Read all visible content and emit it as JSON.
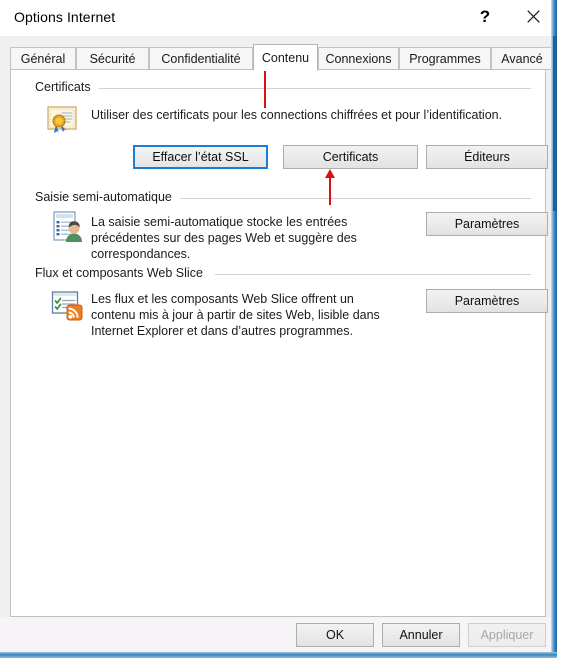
{
  "window": {
    "title": "Options Internet",
    "help_button": "?",
    "close_button": "✕",
    "help_icon": "question-mark-icon",
    "close_icon": "close-x-icon"
  },
  "tabs": [
    {
      "label": "Général",
      "active": false
    },
    {
      "label": "Sécurité",
      "active": false
    },
    {
      "label": "Confidentialité",
      "active": false
    },
    {
      "label": "Contenu",
      "active": true
    },
    {
      "label": "Connexions",
      "active": false
    },
    {
      "label": "Programmes",
      "active": false
    },
    {
      "label": "Avancé",
      "active": false
    }
  ],
  "groups": {
    "certificates": {
      "title": "Certificats",
      "icon": "certificate-seal-icon",
      "description": "Utiliser des certificats pour les connections chiffrées et pour l’identification.",
      "buttons": [
        {
          "label": "Effacer l’état SSL",
          "state": "focused"
        },
        {
          "label": "Certificats",
          "state": "normal"
        },
        {
          "label": "Éditeurs",
          "state": "normal"
        }
      ]
    },
    "autocomplete": {
      "title": "Saisie semi-automatique",
      "icon": "autocomplete-form-person-icon",
      "description": "La saisie semi-automatique stocke les entrées précédentes sur des pages Web et suggère des correspondances.",
      "settings_button": "Paramètres"
    },
    "feeds": {
      "title": "Flux et composants Web Slice",
      "icon": "rss-webslice-icon",
      "description": "Les flux et les composants Web Slice offrent un contenu mis à jour à partir de sites Web, lisible dans Internet Explorer et dans d’autres programmes.",
      "settings_button": "Paramètres"
    }
  },
  "footer": {
    "ok": "OK",
    "cancel": "Annuler",
    "apply": "Appliquer",
    "apply_disabled": true
  },
  "annotations": [
    {
      "name": "arrow-to-contenu-tab",
      "target": "Contenu"
    },
    {
      "name": "arrow-to-certificats-button",
      "target": "Certificats"
    }
  ],
  "colors": {
    "accent": "#1a7fd4",
    "annotation": "#d81212",
    "window_border": "#3d86bf",
    "panel_bg": "#ffffff",
    "dialog_bg": "#f0f0f0"
  }
}
